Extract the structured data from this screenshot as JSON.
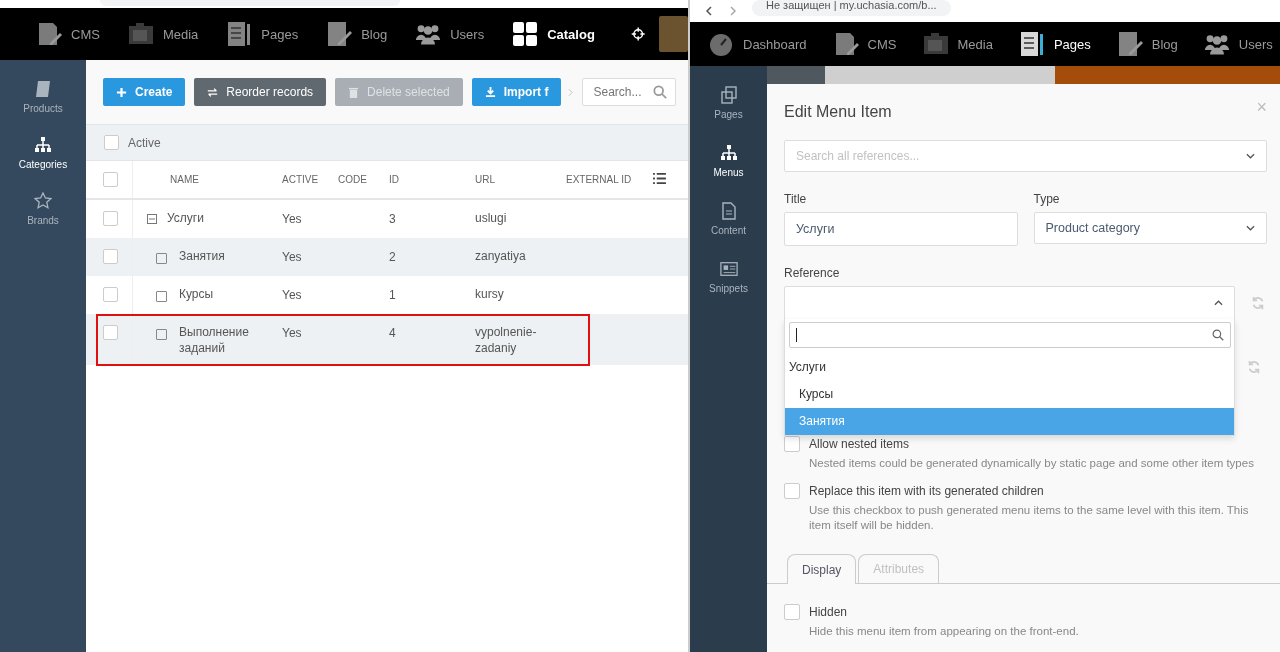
{
  "left_window": {
    "nav": [
      {
        "label": "CMS",
        "selected": false
      },
      {
        "label": "Media",
        "selected": false
      },
      {
        "label": "Pages",
        "selected": false
      },
      {
        "label": "Blog",
        "selected": false
      },
      {
        "label": "Users",
        "selected": false
      },
      {
        "label": "Catalog",
        "selected": true
      }
    ],
    "sidebar": [
      {
        "label": "Products",
        "selected": false
      },
      {
        "label": "Categories",
        "selected": true
      },
      {
        "label": "Brands",
        "selected": false
      }
    ],
    "toolbar": [
      {
        "label": "Create",
        "kind": "primary"
      },
      {
        "label": "Reorder records",
        "kind": "dark"
      },
      {
        "label": "Delete selected",
        "kind": "disabled"
      },
      {
        "label": "Import f",
        "kind": "primary"
      }
    ],
    "search": {
      "placeholder": "Search..."
    },
    "filter": {
      "label": "Active",
      "checked": false
    },
    "table": {
      "all_checked": false,
      "columns": [
        "NAME",
        "ACTIVE",
        "CODE",
        "ID",
        "URL",
        "EXTERNAL ID"
      ],
      "rows": [
        {
          "name": "Услуги",
          "active": "Yes",
          "id": "3",
          "url": "uslugi",
          "checked": false,
          "expanded": true,
          "children": [
            {
              "name": "Занятия",
              "active": "Yes",
              "id": "2",
              "url": "zanyatiya",
              "checked": false
            },
            {
              "name": "Курсы",
              "active": "Yes",
              "id": "1",
              "url": "kursy",
              "checked": false
            },
            {
              "name": "Выполнение заданий",
              "active": "Yes",
              "id": "4",
              "url": "vypolnenie-zadaniy",
              "checked": false,
              "highlighted": true
            }
          ]
        }
      ]
    }
  },
  "right_window": {
    "address": "Не защищен | my.uchasia.com/b...",
    "nav": [
      {
        "label": "Dashboard",
        "selected": false
      },
      {
        "label": "CMS",
        "selected": false
      },
      {
        "label": "Media",
        "selected": false
      },
      {
        "label": "Pages",
        "selected": true
      },
      {
        "label": "Blog",
        "selected": false
      },
      {
        "label": "Users",
        "selected": false
      }
    ],
    "sidebar": [
      {
        "label": "Pages",
        "selected": false
      },
      {
        "label": "Menus",
        "selected": true
      },
      {
        "label": "Content",
        "selected": false
      },
      {
        "label": "Snippets",
        "selected": false
      }
    ],
    "modal": {
      "title": "Edit Menu Item",
      "close": "×",
      "reference_search": {
        "placeholder": "Search all references..."
      },
      "title_field": {
        "label": "Title",
        "value": "Услуги"
      },
      "type_field": {
        "label": "Type",
        "value": "Product category"
      },
      "reference": {
        "label": "Reference",
        "open": true,
        "options": [
          {
            "label": "Услуги",
            "selected": false,
            "children": [
              {
                "label": "Курсы",
                "selected": false
              },
              {
                "label": "Занятия",
                "selected": true
              }
            ]
          }
        ]
      },
      "checkboxes": [
        {
          "label": "Allow nested items",
          "help": "Nested items could be generated dynamically by static page and some other item types",
          "checked": false
        },
        {
          "label": "Replace this item with its generated children",
          "help": "Use this checkbox to push generated menu items to the same level with this item. This item itself will be hidden.",
          "checked": false
        }
      ],
      "tabs": [
        {
          "label": "Display",
          "selected": true
        },
        {
          "label": "Attributes",
          "selected": false
        }
      ],
      "display_options": [
        {
          "label": "Hidden",
          "help": "Hide this menu item from appearing on the front-end.",
          "checked": false
        }
      ]
    }
  }
}
